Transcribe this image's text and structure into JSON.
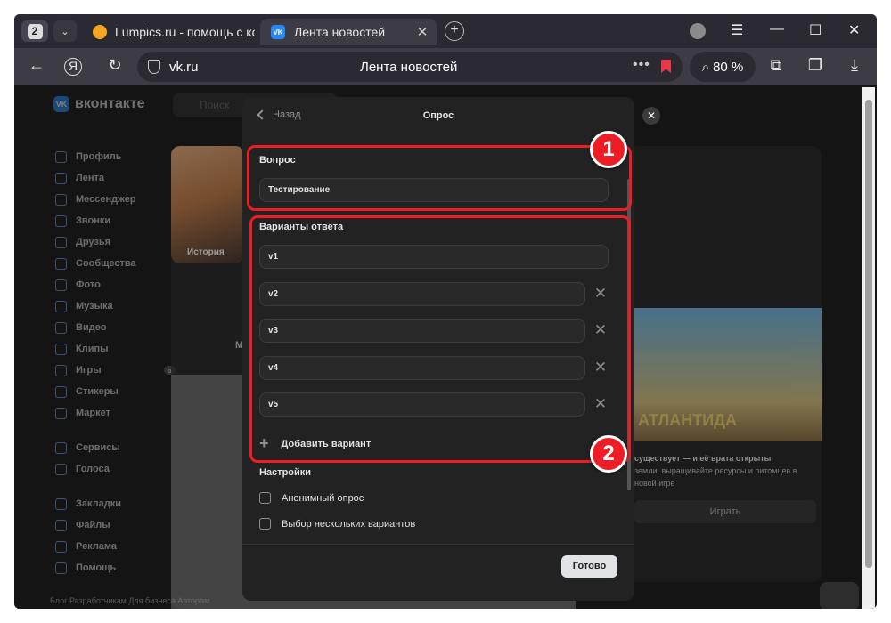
{
  "browser": {
    "tab_count": "2",
    "tabs": [
      {
        "title": "Lumpics.ru - помощь с ком"
      },
      {
        "title": "Лента новостей"
      }
    ],
    "url_domain": "vk.ru",
    "page_title": "Лента новостей",
    "zoom": "80 %"
  },
  "vk": {
    "logo": "вконтакте",
    "search_placeholder": "Поиск",
    "sidebar": [
      "Профиль",
      "Лента",
      "Мессенджер",
      "Звонки",
      "Друзья",
      "Сообщества",
      "Фото",
      "Музыка",
      "Видео",
      "Клипы",
      "Игры",
      "Стикеры",
      "Маркет"
    ],
    "sidebar2": [
      "Сервисы",
      "Голоса"
    ],
    "sidebar3": [
      "Закладки",
      "Файлы",
      "Реклама",
      "Помощь"
    ],
    "games_badge": "6",
    "story_label": "История",
    "post_author": "Mine",
    "footer": "Блог  Разработчикам  Для бизнеса  Авторам",
    "ad_title": "АТЛАНТИДА",
    "ad_text": "существует — и её врата открыты",
    "ad_text2": "земли, выращивайте ресурсы и питомцев в новой игре",
    "play": "Играть"
  },
  "poll": {
    "back": "Назад",
    "title": "Опрос",
    "question_label": "Вопрос",
    "question_value": "Тестирование",
    "answers_label": "Варианты ответа",
    "answers": [
      "v1",
      "v2",
      "v3",
      "v4",
      "v5"
    ],
    "add_option": "Добавить вариант",
    "settings_label": "Настройки",
    "settings": [
      "Анонимный опрос",
      "Выбор нескольких вариантов"
    ],
    "done": "Готово"
  },
  "annotations": {
    "badge1": "1",
    "badge2": "2",
    "color": "#ee1c24"
  }
}
